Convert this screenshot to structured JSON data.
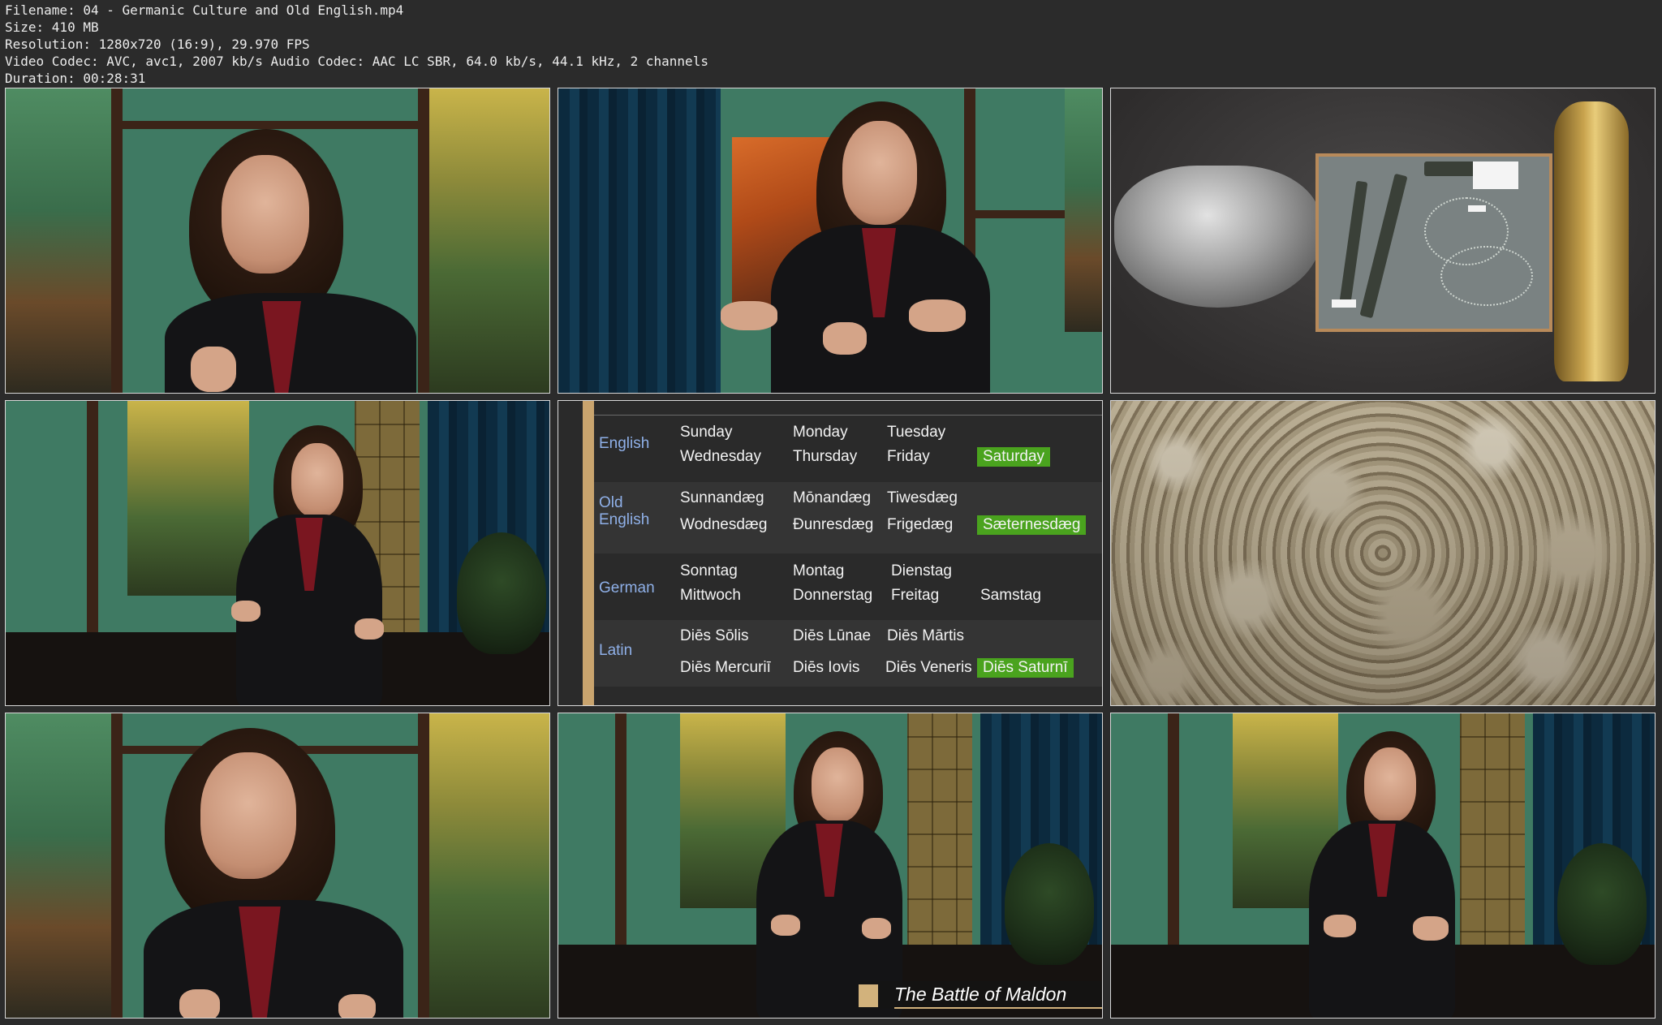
{
  "info": {
    "filename": "Filename: 04 - Germanic Culture and Old English.mp4",
    "size": "Size: 410 MB",
    "resolution": "Resolution: 1280x720 (16:9), 29.970 FPS",
    "codec": "Video Codec: AVC, avc1, 2007 kb/s Audio Codec: AAC LC SBR, 64.0 kb/s, 44.1 kHz, 2 channels",
    "duration": "Duration: 00:28:31"
  },
  "slide": {
    "rows": [
      {
        "lang": "English",
        "days": [
          "Sunday",
          "Monday",
          "Tuesday",
          "Wednesday",
          "Thursday",
          "Friday",
          "Saturday"
        ]
      },
      {
        "lang": "Old English",
        "days": [
          "Sunnandæg",
          "Mōnandæg",
          "Tiwesdæg",
          "Wodnesdæg",
          "Đunresdæg",
          "Frigedæg",
          "Sæternesdæg"
        ]
      },
      {
        "lang": "German",
        "days": [
          "Sonntag",
          "Montag",
          "Dienstag",
          "Mittwoch",
          "Donnerstag",
          "Freitag",
          "Samstag"
        ]
      },
      {
        "lang": "Latin",
        "days": [
          "Diēs Sōlis",
          "Diēs Lūnae",
          "Diēs Mārtis",
          "Diēs Mercuriī",
          "Diēs Iovis",
          "Diēs Veneris",
          "Diēs Saturnī"
        ]
      }
    ],
    "highlight_color": "#4aa31e",
    "label_color": "#8fb0e8"
  },
  "caption": {
    "title": "The Battle of Maldon"
  }
}
